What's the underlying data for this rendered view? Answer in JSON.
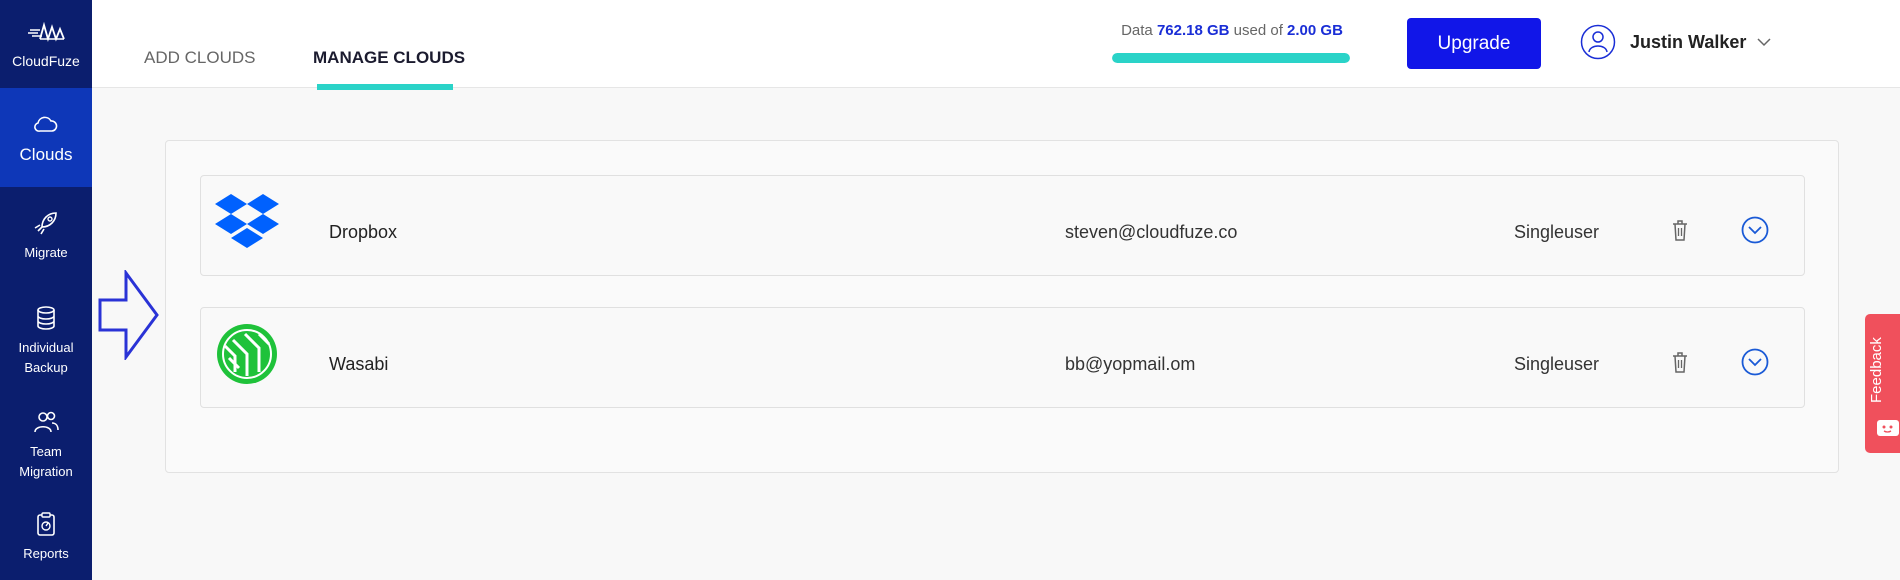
{
  "sidebar": {
    "brand": "CloudFuze",
    "items": [
      {
        "label": "Clouds",
        "icon": "cloud-icon",
        "active": true
      },
      {
        "label": "Migrate",
        "icon": "rocket-icon"
      },
      {
        "label": "Individual Backup",
        "icon": "database-icon"
      },
      {
        "label": "Team Migration",
        "icon": "users-icon"
      },
      {
        "label": "Reports",
        "icon": "clipboard-icon"
      }
    ]
  },
  "header": {
    "tabs": [
      {
        "label": "ADD CLOUDS"
      },
      {
        "label": "MANAGE CLOUDS",
        "active": true
      }
    ],
    "usage": {
      "prefix": "Data",
      "used": "762.18 GB",
      "middle": "used of",
      "total": "2.00 GB",
      "fill_percent": 100
    },
    "upgrade_label": "Upgrade",
    "user_name": "Justin Walker"
  },
  "clouds": [
    {
      "name": "Dropbox",
      "email": "steven@cloudfuze.co",
      "type": "Singleuser",
      "icon": "dropbox-logo-icon"
    },
    {
      "name": "Wasabi",
      "email": "bb@yopmail.om",
      "type": "Singleuser",
      "icon": "wasabi-logo-icon"
    }
  ],
  "feedback_label": "Feedback",
  "colors": {
    "sidebar": "#0b1e6e",
    "sidebar_active": "#0e37b8",
    "accent_teal": "#2ad3c8",
    "upgrade": "#1116e8",
    "feedback": "#f0505c",
    "dropbox": "#0061fe",
    "wasabi": "#1fc23a"
  }
}
